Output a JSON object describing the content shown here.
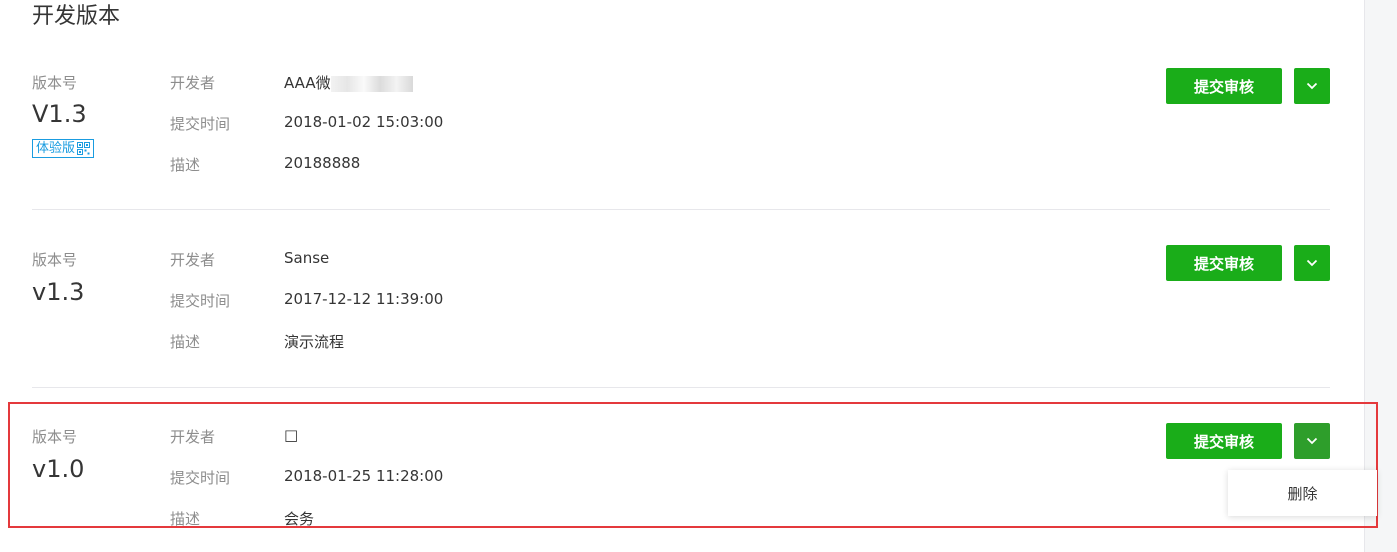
{
  "section_title": "开发版本",
  "versions": [
    {
      "label": "版本号",
      "number": "V1.3",
      "tag": "体验版",
      "developer_label": "开发者",
      "developer": "AAA微",
      "time_label": "提交时间",
      "time": "2018-01-02 15:03:00",
      "desc_label": "描述",
      "desc": "20188888",
      "submit_label": "提交审核"
    },
    {
      "label": "版本号",
      "number": "v1.3",
      "developer_label": "开发者",
      "developer": "Sanse",
      "time_label": "提交时间",
      "time": "2017-12-12 11:39:00",
      "desc_label": "描述",
      "desc": "演示流程",
      "submit_label": "提交审核"
    },
    {
      "label": "版本号",
      "number": "v1.0",
      "developer_label": "开发者",
      "developer": "□",
      "time_label": "提交时间",
      "time": "2018-01-25 11:28:00",
      "desc_label": "描述",
      "desc": "会务",
      "submit_label": "提交审核"
    }
  ],
  "dropdown": {
    "delete_label": "删除"
  },
  "colors": {
    "primary": "#1aad19",
    "tag": "#1a9ce0",
    "highlight": "#e4393c"
  },
  "icons": {
    "more": "chevron-down-icon",
    "qrcode": "qrcode-icon"
  }
}
